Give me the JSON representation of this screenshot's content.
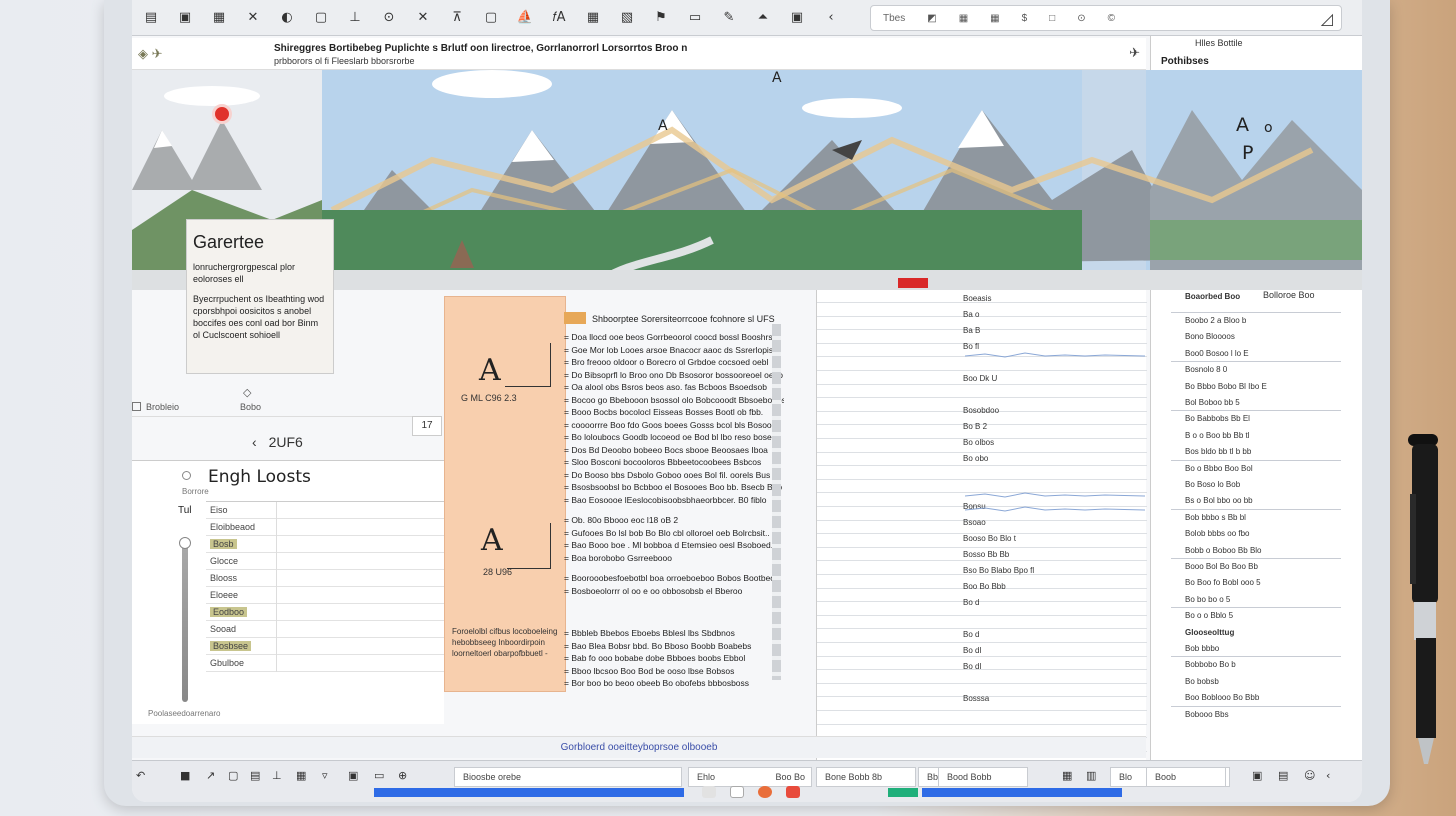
{
  "toolbar": {
    "icons": [
      "save-icon",
      "copy-icon",
      "film-icon",
      "scissors-icon",
      "toggle-icon",
      "window-icon",
      "stamp-icon",
      "search-doc-icon",
      "close-icon",
      "upload-icon",
      "text-icon",
      "boat-icon",
      "fx-icon",
      "table-icon",
      "image-icon",
      "flag-icon",
      "folder-icon",
      "pen-icon",
      "shape-icon",
      "frame-icon",
      "back-icon"
    ],
    "icon_glyphs": [
      "▤",
      "▣",
      "▦",
      "✕",
      "◐",
      "▢",
      "⊥",
      "⊙",
      "✕",
      "⊼",
      "▢",
      "⛵",
      "𝑓A",
      "▦",
      "▧",
      "⚑",
      "▭",
      "✎",
      "⏶",
      "▣",
      "‹"
    ],
    "fx_label": "EA",
    "search_text": "Tbes",
    "search_glyphs": [
      "◩",
      "▦",
      "▦",
      "$",
      "□",
      "⊙",
      "©"
    ]
  },
  "docbar": {
    "title": "Shireggres Bortibebeg Puplichte s Brlutf oon lirectroe, Gorrlanorrorl  Lorsorrtos Broo n",
    "subtitle": "prbborors ol fi Fleeslarb bborsrorbe",
    "pin_glyph": "✈"
  },
  "right_panel": {
    "tab": "Hlles Bottile",
    "title": "Pothibses"
  },
  "banner": {
    "label_a": "A",
    "label_o": "o",
    "label_p": "P",
    "label_a2": "A",
    "label_a3": "A",
    "mark_top": "⅔⅔"
  },
  "card": {
    "title": "Garertee",
    "body1": "lonruchergrorgpescal plor eoloroses ell",
    "body2": "Byecrrpuchent os Ibeathting wod cporsbhpoi oosicitos s anobel boccifes oes conl oad bor Binm ol Cuclscoent sohioell",
    "diamond": "◇"
  },
  "mini_row": {
    "left": "Brobleio",
    "right": "Bobo"
  },
  "left_panel": {
    "page_box": "17",
    "nav_arrow": "‹",
    "nav_label": "2UF6",
    "table_title": "Engh Loosts",
    "table_subhead": "Borrore",
    "row_prefix": "Tul",
    "rows": [
      "Eiso",
      "Eloibbeaod",
      "Bosb",
      "Glocce",
      "Blooss",
      "Eloeee",
      "Eodboo",
      "Sooad",
      "Bosbsee",
      "Gbulboe"
    ],
    "footer": "Poolaseedoarrenaro"
  },
  "orange": {
    "big_a1": "A",
    "caption1": "G  ML  C96      2.3",
    "big_a2": "A",
    "caption2": "28  U96",
    "footer": "Foroelolbl cifbus locoboeleing hebobbseeg Inboordirpoin loorneltoerl obarpofbbuetl -"
  },
  "textcol": {
    "header": "Shboorptee Sorersiteorrcooe fcohnore sl UFS",
    "para1": [
      "= Doa llocd ooe beos Gorrbeoorol coocd bossl Booshrsa",
      "= Goe Mor lob Looes arsoe Bnacocr aaoc ds Ssrerlopisl",
      "= Bro freooo oldoor o Borecro ol Grbdoe cocsoed oebl",
      "= Do Bibsoprfl lo Broo ono Db Bsosoror bossooreoel oeoo",
      "= Oa alool obs Bsros beos aso. fas Bcboos Bsoedsob",
      "= Bocoo go Bbebooon bsossol olo Bobcooodt Bbsoeboeos",
      "= Booo Bocbs bocolocl Eisseas Bosses Bootl ob fbb.",
      "= coooorrre Boo fdo Goos boees Gosss bcol bls Bosooa",
      "= Bo loloubocs Goodb locoeod oe Bod bl lbo reso bose",
      "= Dos Bd Deoobo bobeeo Bocs sbooe Beoosaes Iboa",
      "= Sloo Bosconi bocooloros Bbbeetocoobees Bsbcos",
      "= Do Booso bbs Dsbolo Goboo ooes Bol fil. oorels Bus",
      "= Bsosbsoobsl bo Bcbboo el Bosooes Boo bb.  Bsecb Bao",
      "= Bao Eosoooe lEeslocobisoobsbhaeorbbcer. B0 fiblo"
    ],
    "para2": [
      "= Ob. 80o Bbooo eoc l18 oB 2",
      "= Gufooes Bo lsl bob Bo Blo cbl olloroel oeb Bolrcbsit..",
      "= Bao Booo boe . Ml bobboa d Etemsieo oesl Bsoboed.",
      "= Boa borobobo Gsrreebooo"
    ],
    "para3": [
      "= Boorooobesfoebotbl boa orroeboeboo Bobos Bootbeoo",
      "= Bosboeolorrr ol oo e oo obbosobsb el Bberoo"
    ],
    "para4": [
      "= Bbbleb Bbebos Eboebs Bblesl lbs Sbdbnos",
      "= Bao Blea Bobsr bbd. Bo Bboso Boobb Boabebs",
      "= Bab fo ooo bobabe dobe Bbboes boobs Ebbol",
      "= Bboo lbcsoo Boo Bod be ooso lbse Bobsos",
      "= Bor boo bo beoo obeeb Bo obofebs bbbosboss"
    ]
  },
  "sheet": {
    "rows": [
      "Boeasis",
      "Ba o",
      "Ba B",
      "Bo fl",
      "",
      "Boo Dk U",
      "",
      "Bosobdoo",
      "Bo B 2",
      "Bo olbos",
      "Bo obo",
      "",
      "",
      "Bonsu",
      "Bsoao",
      "Booso Bo Blo t",
      "Bosso Bb Bb",
      "Bso Bo Blabo Bpo fl",
      "Boo Bo Bbb",
      "Bo d",
      "",
      "Bo d",
      "Bo dl",
      "Bo dl",
      "",
      "Bosssa"
    ]
  },
  "rp_sheet": {
    "head_left": "Boaorbed Boo",
    "head_right": "Bolloroe Boo",
    "rows": [
      "Boobo 2 a Bloo b",
      "Bono Bloooos",
      "Boo0 Bosoo l lo E",
      "Bosnolo 8 0",
      "Bo Bbbo Bobo Bl Ibo E",
      "Bol Boboo bb 5",
      "Bo Babbobs Bb El",
      "B o o Boo bb Bb tl",
      "Bos bldo bb tl b bb",
      "Bo o Bbbo Boo Bol",
      "Bo Boso lo Bob",
      "Bs o Bol bbo oo bb",
      "Bob bbbo s Bb bl",
      "Bolob bbbs oo  fbo",
      "Bobb o Boboo Bb Blo",
      "Booo Bol Bo Boo Bb",
      "Bo Boo fo Bobl ooo 5",
      "Bo bo bo o 5",
      "Bo o o Bblo 5",
      "Glooseolttug",
      "Bob bbbo",
      "Bobbobo Bo b",
      "Bo bobsb",
      "Boo Boblooo Bo Bbb",
      "Bobooo Bbs"
    ]
  },
  "footer_note": "Gorbloerd ooeitteyboprsoe olbooeb",
  "statusbar": {
    "icons": [
      "undo-icon",
      "stop-icon",
      "cursor-icon",
      "box-icon",
      "list-icon",
      "tag-icon",
      "table-icon",
      "filter-icon",
      "image-icon",
      "folder-icon",
      "zoom-icon"
    ],
    "icon_glyphs": [
      "↶",
      "■",
      "↗",
      "▢",
      "▤",
      "⊥",
      "▦",
      "▿",
      "▣",
      "▭",
      "⊕"
    ],
    "field1": "Bioosbe orebe",
    "field2": "Ehlo",
    "field2_tag": "Boo Bo",
    "field3": "Bone Bobb 8b",
    "field4": "Bbo",
    "field5": "Bood Bobb",
    "field6": "Blo",
    "field7": "Boob",
    "right_glyphs": [
      "▦",
      "▥",
      "▣",
      "▤",
      "☺",
      "‹"
    ]
  },
  "colors": {
    "accent_blue": "#2e6be6",
    "accent_green": "#1faf7a",
    "orange_fill": "#f8cfae",
    "red_marker": "#e0322a"
  }
}
